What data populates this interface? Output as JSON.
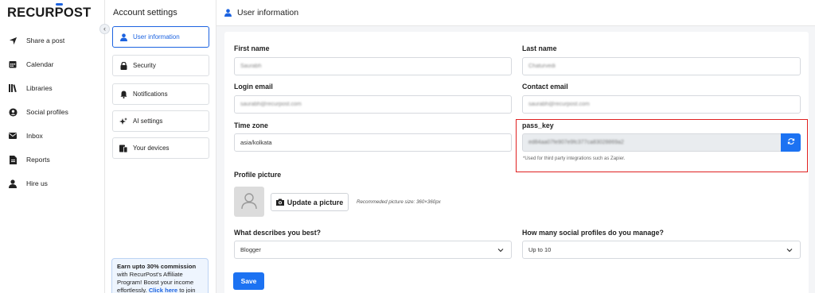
{
  "brand": {
    "logo_text": "RECURPOST",
    "logo_part1": "RECUR",
    "logo_u": "P",
    "logo_part2": "OST",
    "accent": "#1c63e0"
  },
  "nav": {
    "collapse_icon": "‹",
    "items": [
      {
        "label": "Share a post",
        "icon": "send-icon"
      },
      {
        "label": "Calendar",
        "icon": "calendar-icon"
      },
      {
        "label": "Libraries",
        "icon": "library-icon"
      },
      {
        "label": "Social profiles",
        "icon": "user-circle-icon"
      },
      {
        "label": "Inbox",
        "icon": "inbox-icon"
      },
      {
        "label": "Reports",
        "icon": "report-icon"
      },
      {
        "label": "Hire us",
        "icon": "person-icon"
      }
    ]
  },
  "settings_menu": {
    "title": "Account settings",
    "items": [
      {
        "label": "User information",
        "icon": "user-icon",
        "active": true
      },
      {
        "label": "Security",
        "icon": "lock-icon"
      },
      {
        "label": "Notifications",
        "icon": "bell-icon"
      },
      {
        "label": "AI settings",
        "icon": "sparkle-icon"
      },
      {
        "label": "Your devices",
        "icon": "devices-icon"
      }
    ]
  },
  "promo": {
    "bold": "Earn upto 30% commission",
    "text": " with RecurPost's Affiliate Program! Boost your income effortlessly. ",
    "link": "Click here",
    "tail": " to join"
  },
  "header": {
    "title": "User information",
    "icon": "user-icon"
  },
  "form": {
    "first_name": {
      "label": "First name",
      "value": "Saurabh"
    },
    "last_name": {
      "label": "Last name",
      "value": "Chaturvedi"
    },
    "login_email": {
      "label": "Login email",
      "value": "saurabh@recurpost.com"
    },
    "contact_email": {
      "label": "Contact email",
      "value": "saurabh@recurpost.com"
    },
    "time_zone": {
      "label": "Time zone",
      "value": "asia/kolkata"
    },
    "pass_key": {
      "label": "pass_key",
      "value": "ed84aa07fe907e9fc377ca83028869a2",
      "note": "*Used for third party integrations such as Zapier.",
      "refresh_icon": "refresh-icon"
    },
    "profile_picture": {
      "label": "Profile picture",
      "button": "Update a picture",
      "hint": "Recommeded picture size: 360×360px"
    },
    "describes": {
      "label": "What describes you best?",
      "value": "Blogger"
    },
    "profiles_count": {
      "label": "How many social profiles do you manage?",
      "value": "Up to 10"
    },
    "save": "Save"
  },
  "colors": {
    "primary": "#1c72f2",
    "highlight_border": "#e02020"
  }
}
